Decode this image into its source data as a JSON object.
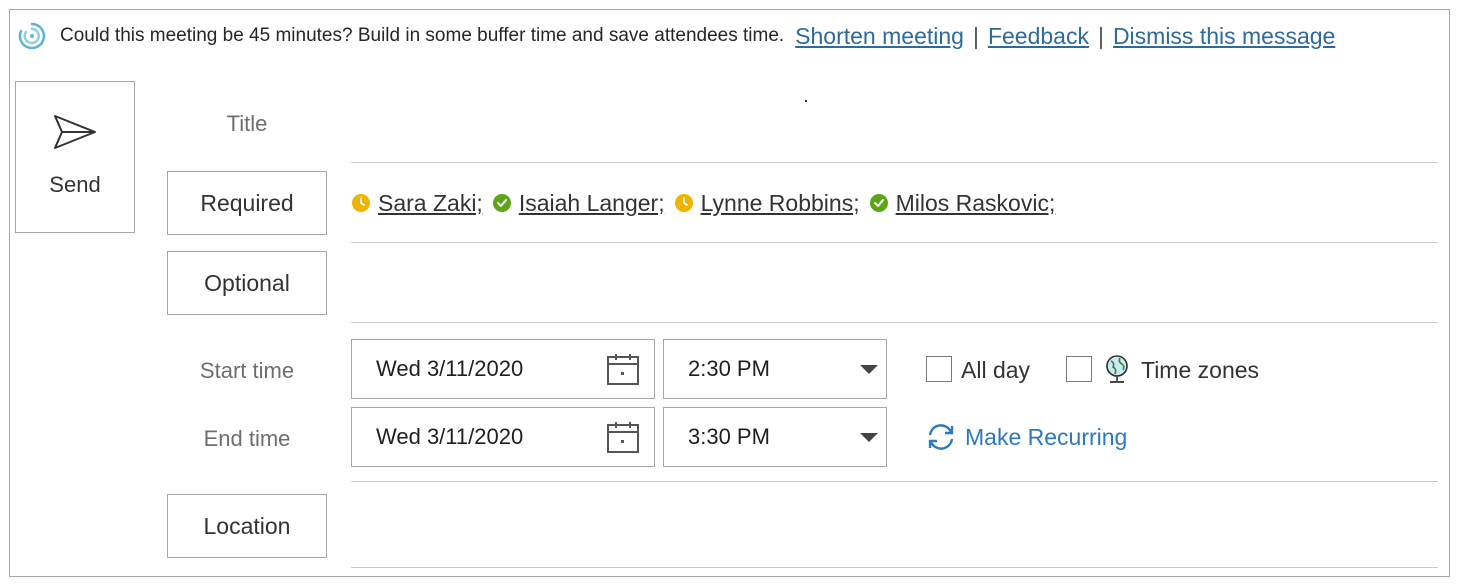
{
  "infobar": {
    "message": "Could this meeting be 45 minutes? Build in some buffer time and save attendees time.",
    "links": {
      "shorten": "Shorten meeting",
      "feedback": "Feedback",
      "dismiss": "Dismiss this message"
    },
    "separator": "|",
    "icon": "scheduling-assistant-spinner-icon"
  },
  "send": {
    "label": "Send",
    "icon": "send-arrow-icon"
  },
  "fields": {
    "title_label": "Title",
    "title_value": "",
    "required_label": "Required",
    "optional_label": "Optional",
    "optional_value": "",
    "start_label": "Start time",
    "end_label": "End time",
    "location_label": "Location",
    "location_value": ""
  },
  "attendees": [
    {
      "name": "Sara Zaki;",
      "status": "tentative",
      "status_color": "#f0b400"
    },
    {
      "name": "Isaiah Langer;",
      "status": "available",
      "status_color": "#5ca518"
    },
    {
      "name": "Lynne Robbins;",
      "status": "tentative",
      "status_color": "#f0b400"
    },
    {
      "name": "Milos Raskovic;",
      "status": "available",
      "status_color": "#5ca518"
    }
  ],
  "start": {
    "date": "Wed 3/11/2020",
    "time": "2:30 PM"
  },
  "end": {
    "date": "Wed 3/11/2020",
    "time": "3:30 PM"
  },
  "options": {
    "all_day_label": "All day",
    "all_day_checked": false,
    "time_zones_label": "Time zones",
    "time_zones_checked": false,
    "make_recurring_label": "Make Recurring"
  },
  "colors": {
    "link": "#2e6a9c",
    "recurring": "#2e78c0",
    "border": "#a6a6a6"
  }
}
